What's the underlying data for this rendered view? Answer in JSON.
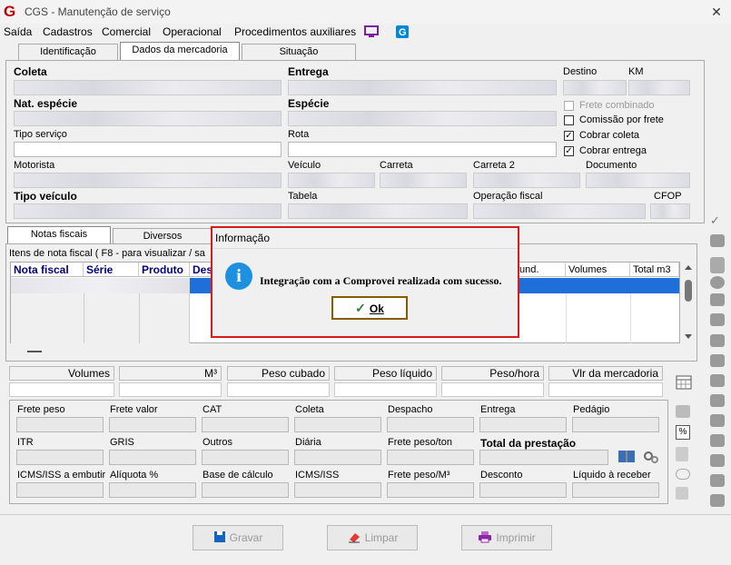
{
  "window": {
    "title": "CGS - Manutenção de serviço",
    "close_glyph": "✕",
    "logo": "G"
  },
  "menu": [
    "Saída",
    "Cadastros",
    "Comercial",
    "Operacional",
    "Procedimentos auxiliares"
  ],
  "tabs": [
    "Identificação",
    "Dados da mercadoria",
    "Situação"
  ],
  "form": {
    "coleta": "Coleta",
    "entrega": "Entrega",
    "destino": "Destino",
    "km": "KM",
    "nat_especie": "Nat. espécie",
    "especie": "Espécie",
    "tipo_servico": "Tipo serviço",
    "rota": "Rota",
    "motorista": "Motorista",
    "veiculo": "Veículo",
    "carreta": "Carreta",
    "carreta2": "Carreta 2",
    "documento": "Documento",
    "tipo_veiculo": "Tipo veículo",
    "tabela": "Tabela",
    "operacao_fiscal": "Operação fiscal",
    "cfop": "CFOP"
  },
  "checkboxes": [
    {
      "label": "Frete combinado",
      "checked": false,
      "disabled": true
    },
    {
      "label": "Comissão por frete",
      "checked": false,
      "disabled": false
    },
    {
      "label": "Cobrar coleta",
      "checked": true,
      "disabled": false
    },
    {
      "label": "Cobrar entrega",
      "checked": true,
      "disabled": false
    }
  ],
  "inner_tabs": [
    "Notas fiscais",
    "Diversos"
  ],
  "nf_group_label": "Itens de nota fiscal ( F8 - para visualizar / sa",
  "grid_headers": [
    "Nota fiscal",
    "Série",
    "Produto",
    "Des",
    "fund.",
    "Volumes",
    "Total m3"
  ],
  "totals": [
    "Volumes",
    "M³",
    "Peso cubado",
    "Peso líquido",
    "Peso/hora",
    "Vlr da mercadoria"
  ],
  "values_row1": [
    "Frete peso",
    "Frete valor",
    "CAT",
    "Coleta",
    "Despacho",
    "Entrega",
    "Pedágio"
  ],
  "values_row2": [
    "ITR",
    "GRIS",
    "Outros",
    "Diária",
    "Frete peso/ton",
    "Total da prestação"
  ],
  "values_row3": [
    "ICMS/ISS a embutir",
    "Alíquota %",
    "Base de cálculo",
    "ICMS/ISS",
    "Frete peso/M³",
    "Desconto",
    "Líquido à receber"
  ],
  "buttons": {
    "gravar": "Gravar",
    "limpar": "Limpar",
    "imprimir": "Imprimir"
  },
  "dialog": {
    "title": "Informação",
    "message": "Integração com a Comprovei realizada com sucesso.",
    "ok": "Ok",
    "ok_check": "✓",
    "icon_glyph": "i"
  },
  "colors": {
    "dialog_border": "#d81b1b",
    "info_icon": "#1e90e0",
    "grid_header_text": "#000080",
    "selected_row": "#1e6fd9"
  }
}
